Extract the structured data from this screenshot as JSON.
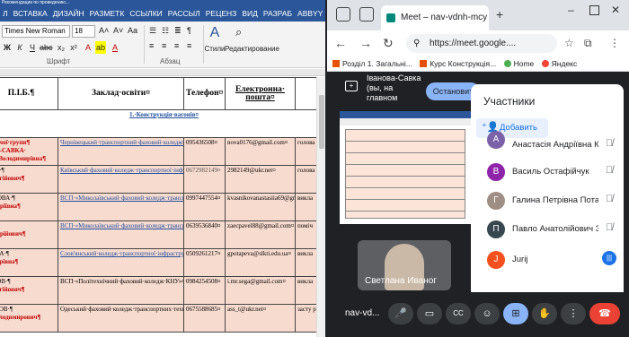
{
  "word": {
    "title_bar": "Рекомендации по проведению...",
    "tabs": [
      "Л",
      "ВСТАВКА",
      "ДИЗАЙН",
      "РАЗМЕТК",
      "ССЫЛКИ",
      "РАССЫЛ",
      "РЕЦЕНЗ",
      "ВИД",
      "РАЗРАБ",
      "ABBYY Fi"
    ],
    "font_name": "Times New Roman",
    "font_size": "18",
    "group_font": "Шрифт",
    "group_paragraph": "Абзац",
    "styles_label": "Стили",
    "editing_label": "Редактирование",
    "headers": [
      "П.І.Б.¶",
      "Заклад·освіти¤",
      "Телефон¤",
      "Електронна· пошта¤",
      ""
    ],
    "section_title": "1.·Конструкція·вагонів¤",
    "rows": [
      {
        "name": [
          "робочої·групи¶",
          "ОВА-САВКА·",
          "ана·Володимирівна¶"
        ],
        "school": "Чернівецький·транспортний·фаховий·коледж¤",
        "phone": "095436508¤",
        "email": "nova0176@gmail.com¤",
        "extra": "голова"
      },
      {
        "name": [
          "КОВ·¶",
          "·Сергійович¶"
        ],
        "school": "Київський·фаховий·коледж·транспортної·інфраструктури¤",
        "phone": "0672982149¤",
        "email": "2982149@ukr.net¤",
        "extra": "голова"
      },
      {
        "name": [
          "НІКОВА·¶",
          "·Андріївна¶"
        ],
        "school": "ВСП·«Миколаївський·фаховий·коледж·транспортної·інфраструктури·Українського·державного·університету·науки·і·технологій»¤",
        "phone": "0997447554¤",
        "email": "kvasnikovanastasiia69@gmail.com¤",
        "extra": "викла"
      },
      {
        "name": [
          "ОВ·¶",
          "·Андрійович¶"
        ],
        "school": "ВСП·«Миколаївський·фаховий·коледж·транспортної·інфраструктури·Українського·державного·університету·науки·і·технологій»¤",
        "phone": "0639536840¤",
        "email": "zaecpavel88@gmail.com¤",
        "extra": "поміч"
      },
      {
        "name": [
          "ПОВА·¶",
          "·Петрівна¶"
        ],
        "school": "Слов'янський·коледж·транспортної·інфраструктури¤",
        "phone": "0509261217¤",
        "email": "gpotapeva@slkti.edu.ua¤",
        "extra": "викла"
      },
      {
        "name": [
          "ИМОВ·¶",
          "·Сергійович¶"
        ],
        "school": "ВСП·«Політехнічний·фаховий·коледж·КНУ»¤",
        "phone": "0984254508¤",
        "email": "i.mr.sega@gmail.com¤",
        "extra": "викла"
      },
      {
        "name": [
          "ЕНКОВ·¶",
          "а·Володимирович¶"
        ],
        "school": "Одеський·фаховий·коледж·транспортних·технологій¶",
        "phone": "0675588685¤",
        "email": "ass_t@ukr.net¤",
        "extra": "засту роботи"
      }
    ]
  },
  "browser": {
    "tab_title": "Meet – nav-vdnh-mcy",
    "url": "https://meet.google....",
    "bookmarks": [
      "Розділ 1. Загальні...",
      "Курс Конструкція...",
      "Home",
      "Яндекс"
    ],
    "presenter_label": "Іванова-Савка (вы, на главном",
    "stop_presenting": "Остановит",
    "tile_name": "Светлана Иваног",
    "meeting_code": "nav-vd...",
    "participants_title": "Участники",
    "add_label": "Добавить",
    "participants": [
      {
        "initial": "А",
        "name": "Анастасія Андріївна Ква...",
        "color": "#7b61a8",
        "mic": "muted"
      },
      {
        "initial": "В",
        "name": "Василь Остафійчук",
        "color": "#8e24aa",
        "mic": "muted"
      },
      {
        "initial": "Г",
        "name": "Галина Петрівна Потап...",
        "color": "#9e8e84",
        "mic": "muted"
      },
      {
        "initial": "П",
        "name": "Павло Анатолійович За...",
        "color": "#37474f",
        "mic": "muted"
      },
      {
        "initial": "J",
        "name": "Jurij",
        "color": "#f4511e",
        "mic": "active"
      }
    ]
  }
}
